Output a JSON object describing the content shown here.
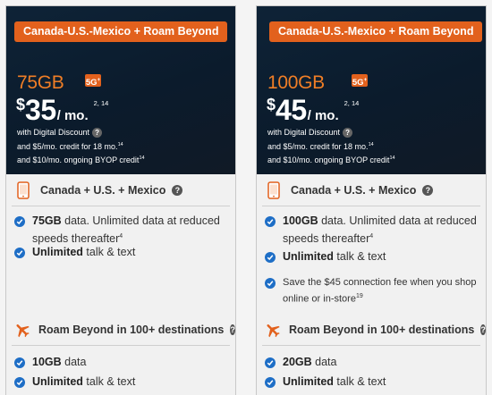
{
  "plans": [
    {
      "roam_button": "Canada-U.S.-Mexico + Roam Beyond",
      "data_gb": "75GB",
      "badge_5g": "5G",
      "badge_5g_sup": "+",
      "currency": "$",
      "price": "35",
      "per": "/ mo.",
      "price_footnote": "2, 14",
      "promo_line1": "with Digital Discount",
      "promo_line2": "and $5/mo. credit for 18 mo.",
      "promo_line2_sup": "14",
      "promo_line3": "and $10/mo. ongoing BYOP credit",
      "promo_line3_sup": "14",
      "section1_title": "Canada + U.S. + Mexico",
      "features1": [
        {
          "bold": "75GB",
          "text": " data. Unlimited data at reduced speeds thereafter",
          "sup": "4"
        },
        {
          "bold": "Unlimited",
          "text": " talk & text",
          "sup": ""
        }
      ],
      "section2_title": "Roam Beyond in 100+ destinations",
      "features2": [
        {
          "bold": "10GB",
          "text": " data",
          "sup": ""
        },
        {
          "bold": "Unlimited",
          "text": " talk & text",
          "sup": ""
        }
      ]
    },
    {
      "roam_button": "Canada-U.S.-Mexico + Roam Beyond",
      "data_gb": "100GB",
      "badge_5g": "5G",
      "badge_5g_sup": "+",
      "currency": "$",
      "price": "45",
      "per": "/ mo.",
      "price_footnote": "2, 14",
      "promo_line1": "with Digital Discount",
      "promo_line2": "and $5/mo. credit for 18 mo.",
      "promo_line2_sup": "14",
      "promo_line3": "and $10/mo. ongoing BYOP credit",
      "promo_line3_sup": "14",
      "section1_title": "Canada + U.S. + Mexico",
      "features1": [
        {
          "bold": "100GB",
          "text": " data. Unlimited data at reduced speeds thereafter",
          "sup": "4"
        },
        {
          "bold": "Unlimited",
          "text": " talk & text",
          "sup": ""
        },
        {
          "bold": "",
          "text": "Save the $45 connection fee when you shop online or in-store",
          "sup": "19"
        }
      ],
      "section2_title": "Roam Beyond in 100+ destinations",
      "features2": [
        {
          "bold": "20GB",
          "text": " data",
          "sup": ""
        },
        {
          "bold": "Unlimited",
          "text": " talk & text",
          "sup": ""
        }
      ]
    }
  ],
  "info_icon_glyph": "?",
  "colors": {
    "accent": "#e2611d",
    "hero_bg": "#0e2337",
    "check": "#1e6ec6",
    "gb_text": "#f07e26"
  },
  "icons": {
    "section1": "phone-icon",
    "section2": "plane-icon",
    "feature": "checkmark-icon",
    "info": "question-circle-icon"
  }
}
